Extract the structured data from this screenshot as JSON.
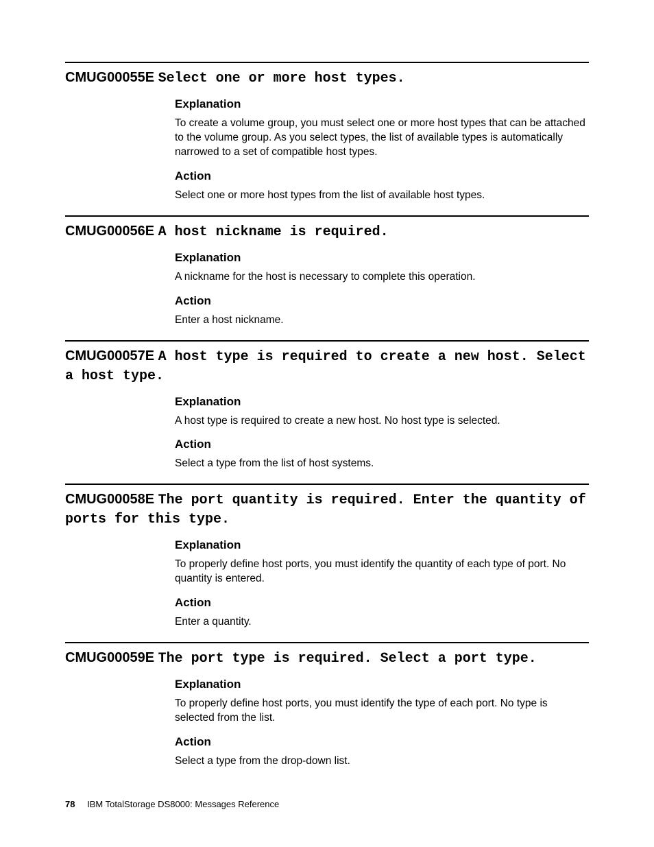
{
  "entries": [
    {
      "code": "CMUG00055E",
      "message": "Select one or more host types.",
      "explanation_heading": "Explanation",
      "explanation": "To create a volume group, you must select one or more host types that can be attached to the volume group. As you select types, the list of available types is automatically narrowed to a set of compatible host types.",
      "action_heading": "Action",
      "action": "Select one or more host types from the list of available host types."
    },
    {
      "code": "CMUG00056E",
      "message": "A host nickname is required.",
      "explanation_heading": "Explanation",
      "explanation": "A nickname for the host is necessary to complete this operation.",
      "action_heading": "Action",
      "action": "Enter a host nickname."
    },
    {
      "code": "CMUG00057E",
      "message": "A host type is required to create a new host. Select a host type.",
      "explanation_heading": "Explanation",
      "explanation": "A host type is required to create a new host. No host type is selected.",
      "action_heading": "Action",
      "action": "Select a type from the list of host systems."
    },
    {
      "code": "CMUG00058E",
      "message": "The port quantity is required. Enter the quantity of ports for this type.",
      "explanation_heading": "Explanation",
      "explanation": "To properly define host ports, you must identify the quantity of each type of port. No quantity is entered.",
      "action_heading": "Action",
      "action": "Enter a quantity."
    },
    {
      "code": "CMUG00059E",
      "message": "The port type is required. Select a port type.",
      "explanation_heading": "Explanation",
      "explanation": "To properly define host ports, you must identify the type of each port. No type is selected from the list.",
      "action_heading": "Action",
      "action": "Select a type from the drop-down list."
    }
  ],
  "footer": {
    "page_number": "78",
    "book_title": "IBM TotalStorage DS8000: Messages Reference"
  }
}
